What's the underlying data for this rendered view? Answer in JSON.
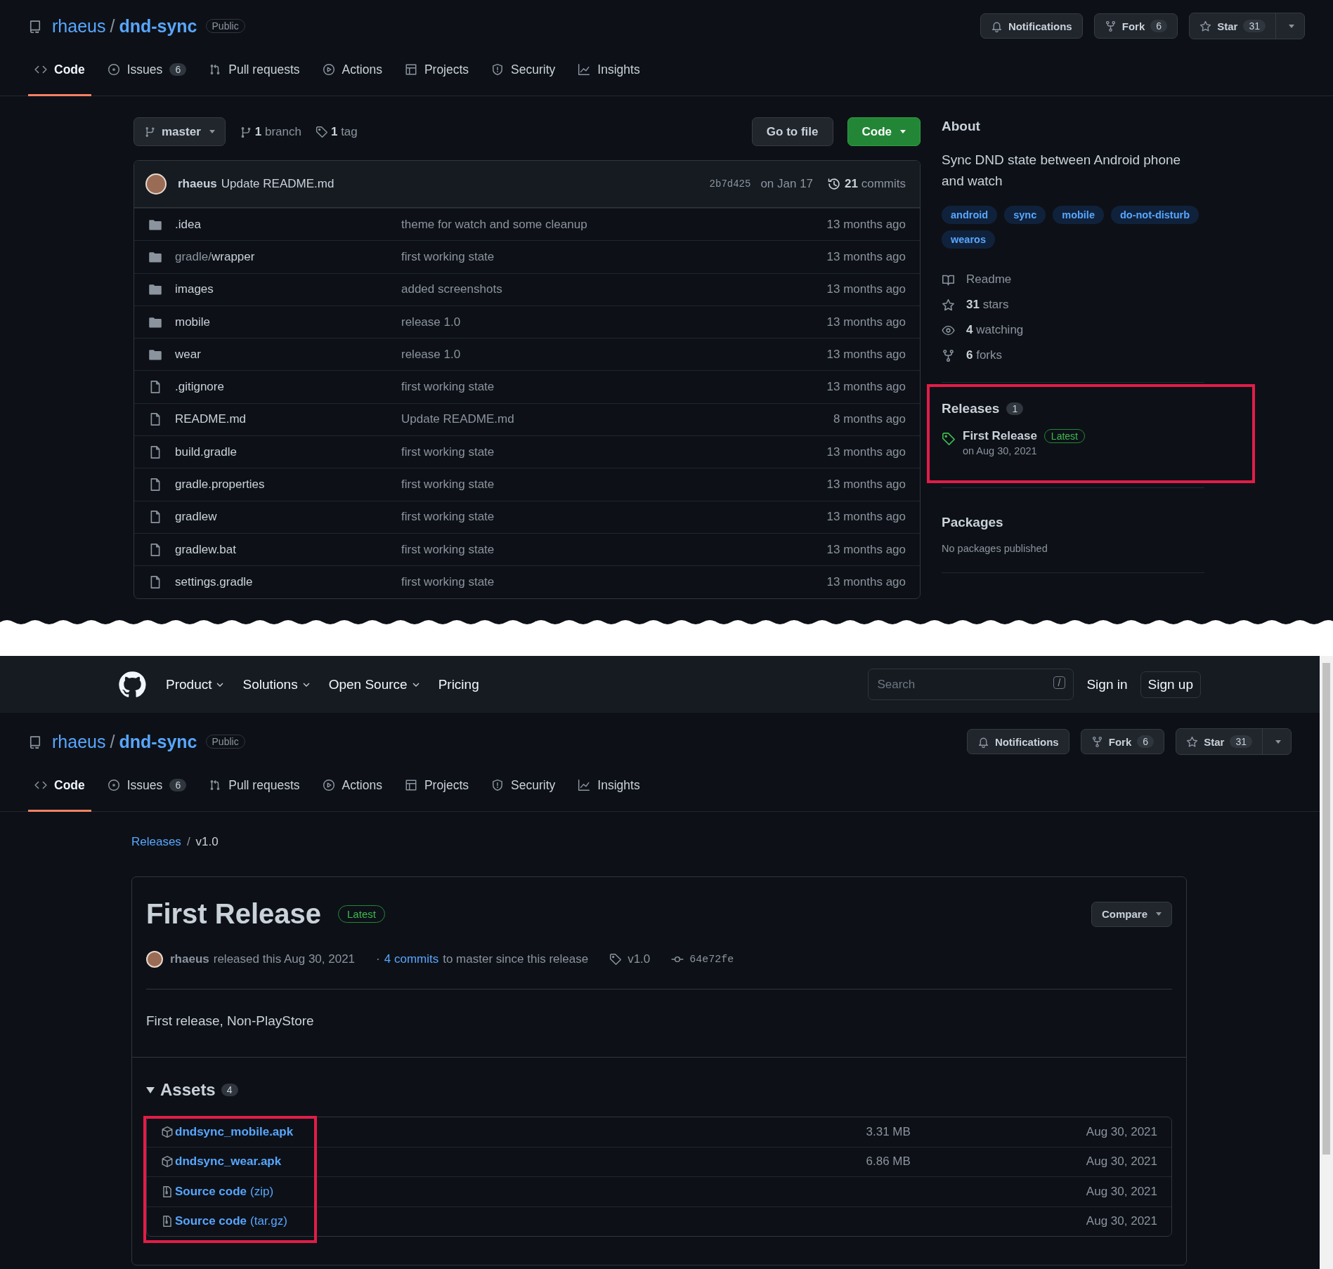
{
  "pages": [
    {
      "kind": "repo",
      "repo_header": {
        "owner": "rhaeus",
        "separator": "/",
        "repo": "dnd-sync",
        "visibility": "Public"
      },
      "actions": [
        {
          "kind": "notifications",
          "label": "Notifications"
        },
        {
          "kind": "fork",
          "label": "Fork",
          "count": "6"
        },
        {
          "kind": "star",
          "label": "Star",
          "count": "31"
        }
      ],
      "tabs": [
        {
          "kind": "code",
          "label": "Code",
          "selected": true
        },
        {
          "kind": "issues",
          "label": "Issues",
          "count": "6",
          "selected": false
        },
        {
          "kind": "pulls",
          "label": "Pull requests",
          "selected": false
        },
        {
          "kind": "actions",
          "label": "Actions",
          "selected": false
        },
        {
          "kind": "projects",
          "label": "Projects",
          "selected": false
        },
        {
          "kind": "security",
          "label": "Security",
          "selected": false
        },
        {
          "kind": "insights",
          "label": "Insights",
          "selected": false
        }
      ],
      "repo": {
        "branch": "master",
        "branch_count": "**1** branch",
        "tag_count": "**1** tag",
        "go_to_file": "Go to file",
        "code_button": "Code",
        "latest_commit": {
          "author": "rhaeus",
          "message": "Update README.md",
          "hash": "2b7d425",
          "date": "on Jan 17",
          "commits": "**21** commits"
        },
        "files": [
          {
            "kind": "folder",
            "name": ".idea",
            "message": "theme for watch and some cleanup",
            "age": "13 months ago"
          },
          {
            "kind": "folder",
            "prefix": "gradle/",
            "name": "wrapper",
            "message": "first working state",
            "age": "13 months ago"
          },
          {
            "kind": "folder",
            "name": "images",
            "message": "added screenshots",
            "age": "13 months ago"
          },
          {
            "kind": "folder",
            "name": "mobile",
            "message": "release 1.0",
            "age": "13 months ago"
          },
          {
            "kind": "folder",
            "name": "wear",
            "message": "release 1.0",
            "age": "13 months ago"
          },
          {
            "kind": "file",
            "name": ".gitignore",
            "message": "first working state",
            "age": "13 months ago"
          },
          {
            "kind": "file",
            "name": "README.md",
            "message": "Update README.md",
            "age": "8 months ago"
          },
          {
            "kind": "file",
            "name": "build.gradle",
            "message": "first working state",
            "age": "13 months ago"
          },
          {
            "kind": "file",
            "name": "gradle.properties",
            "message": "first working state",
            "age": "13 months ago"
          },
          {
            "kind": "file",
            "name": "gradlew",
            "message": "first working state",
            "age": "13 months ago"
          },
          {
            "kind": "file",
            "name": "gradlew.bat",
            "message": "first working state",
            "age": "13 months ago"
          },
          {
            "kind": "file",
            "name": "settings.gradle",
            "message": "first working state",
            "age": "13 months ago"
          }
        ],
        "about": {
          "title": "About",
          "description": "Sync DND state between Android phone and watch",
          "topics": [
            "android",
            "sync",
            "mobile",
            "do-not-disturb",
            "wearos"
          ],
          "links": [
            {
              "kind": "readme",
              "label": "Readme"
            },
            {
              "kind": "stars",
              "label": "**31** stars"
            },
            {
              "kind": "watching",
              "label": "**4** watching"
            },
            {
              "kind": "forks",
              "label": "**6** forks"
            }
          ]
        },
        "releases": {
          "title": "Releases",
          "count": "1",
          "highlighted": true,
          "name": "First Release",
          "badge": "Latest",
          "date": "on Aug 30, 2021"
        },
        "packages": {
          "title": "Packages",
          "text": "No packages published"
        }
      }
    },
    {
      "kind": "release",
      "nav": {
        "items": [
          {
            "label": "Product",
            "dropdown": true
          },
          {
            "label": "Solutions",
            "dropdown": true
          },
          {
            "label": "Open Source",
            "dropdown": true
          },
          {
            "label": "Pricing",
            "dropdown": false
          }
        ],
        "search_placeholder": "Search",
        "search_key": "/",
        "sign_in": "Sign in",
        "sign_up": "Sign up"
      },
      "repo_header": {
        "owner": "rhaeus",
        "separator": "/",
        "repo": "dnd-sync",
        "visibility": "Public"
      },
      "actions": [
        {
          "kind": "notifications",
          "label": "Notifications"
        },
        {
          "kind": "fork",
          "label": "Fork",
          "count": "6"
        },
        {
          "kind": "star",
          "label": "Star",
          "count": "31"
        }
      ],
      "tabs": [
        {
          "kind": "code",
          "label": "Code",
          "selected": true
        },
        {
          "kind": "issues",
          "label": "Issues",
          "count": "6",
          "selected": false
        },
        {
          "kind": "pulls",
          "label": "Pull requests",
          "selected": false
        },
        {
          "kind": "actions",
          "label": "Actions",
          "selected": false
        },
        {
          "kind": "projects",
          "label": "Projects",
          "selected": false
        },
        {
          "kind": "security",
          "label": "Security",
          "selected": false
        },
        {
          "kind": "insights",
          "label": "Insights",
          "selected": false
        }
      ],
      "release": {
        "breadcrumb": {
          "link": "Releases",
          "separator": "/",
          "current": "v1.0"
        },
        "title": "First Release",
        "badge": "Latest",
        "compare": "Compare",
        "author": "rhaeus",
        "released": "released this Aug 30, 2021",
        "separator": "·",
        "commits_link": "4 commits",
        "commits_text": "to master since this release",
        "tag": "v1.0",
        "commit": "64e72fe",
        "body": "First release, Non-PlayStore",
        "assets": {
          "title": "Assets",
          "count": "4",
          "expanded": true,
          "highlighted": true,
          "items": [
            {
              "kind": "package",
              "name": "dndsync_mobile.apk",
              "size": "3.31 MB",
              "date": "Aug 30, 2021"
            },
            {
              "kind": "package",
              "name": "dndsync_wear.apk",
              "size": "6.86 MB",
              "date": "Aug 30, 2021"
            },
            {
              "kind": "archive",
              "name": "Source code",
              "suffix": "(zip)",
              "date": "Aug 30, 2021"
            },
            {
              "kind": "archive",
              "name": "Source code",
              "suffix": "(tar.gz)",
              "date": "Aug 30, 2021"
            }
          ]
        }
      }
    }
  ]
}
